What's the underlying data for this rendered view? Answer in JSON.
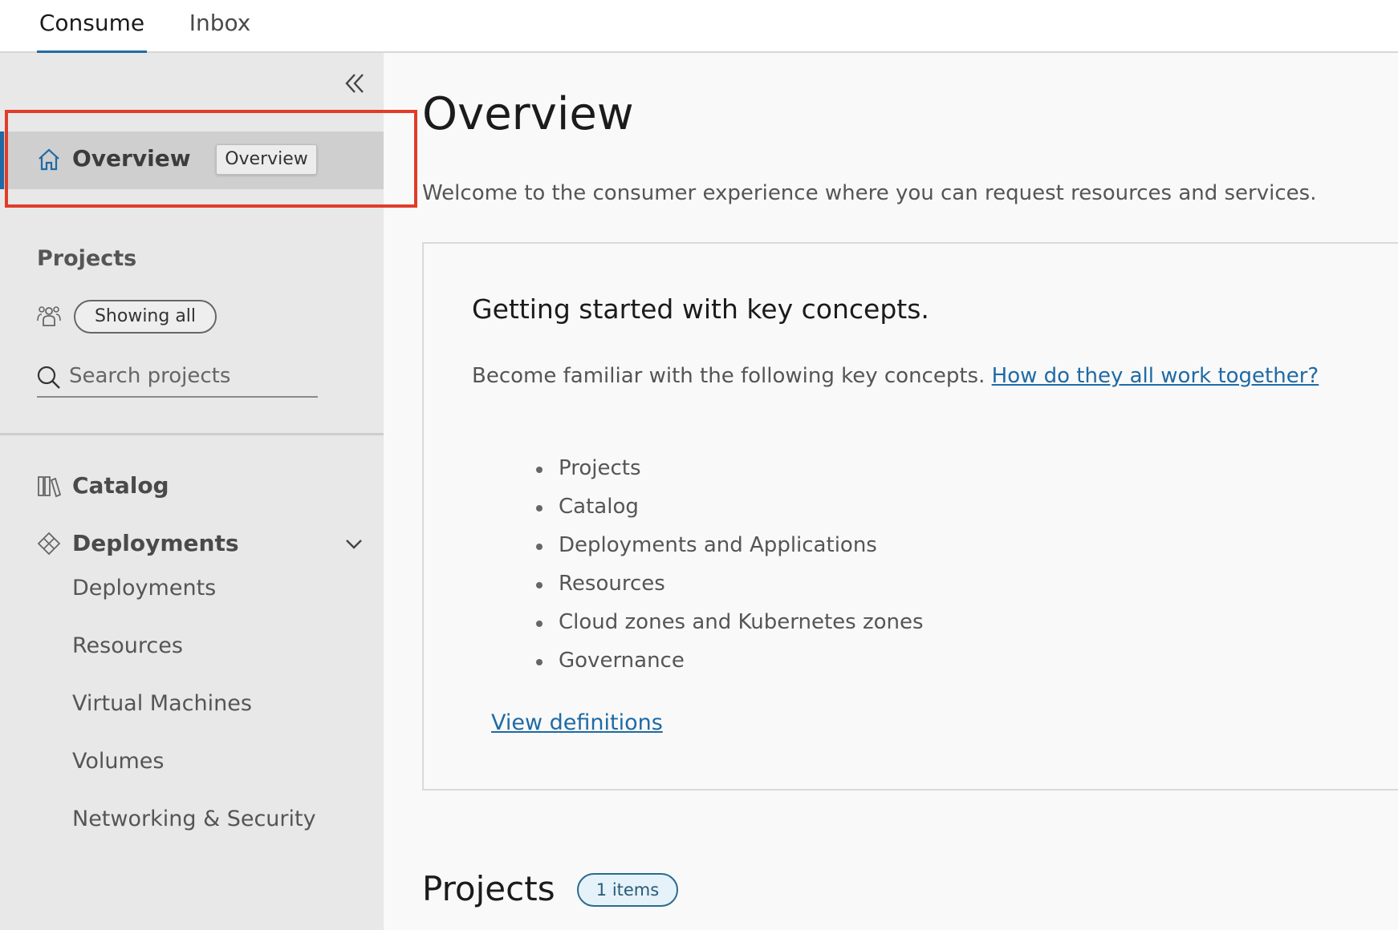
{
  "tabs": {
    "consume": "Consume",
    "inbox": "Inbox"
  },
  "sidebar": {
    "overview_label": "Overview",
    "tooltip": "Overview",
    "projects_heading": "Projects",
    "projects_filter": "Showing all",
    "search_placeholder": "Search projects",
    "catalog_label": "Catalog",
    "deployments_label": "Deployments",
    "deployments_children": [
      "Deployments",
      "Resources",
      "Virtual Machines",
      "Volumes",
      "Networking & Security"
    ]
  },
  "main": {
    "title": "Overview",
    "welcome": "Welcome to the consumer experience where you can request resources and services.",
    "card": {
      "title": "Getting started with key concepts.",
      "intro": "Become familiar with the following key concepts.",
      "intro_link": "How do they all work together?",
      "concepts": [
        "Projects",
        "Catalog",
        "Deployments and Applications",
        "Resources",
        "Cloud zones and Kubernetes zones",
        "Governance"
      ],
      "view_definitions": "View definitions"
    },
    "projects_title": "Projects",
    "projects_count": "1 items"
  },
  "colors": {
    "accent": "#1f6aa5",
    "highlight": "#e03c2a",
    "sidebar_bg": "#e8e8e8",
    "selected_bg": "#cfcfcf"
  },
  "icons": [
    "double-chevron-left-icon",
    "home-icon",
    "people-icon",
    "search-icon",
    "books-icon",
    "deployments-icon",
    "chevron-down-icon"
  ]
}
